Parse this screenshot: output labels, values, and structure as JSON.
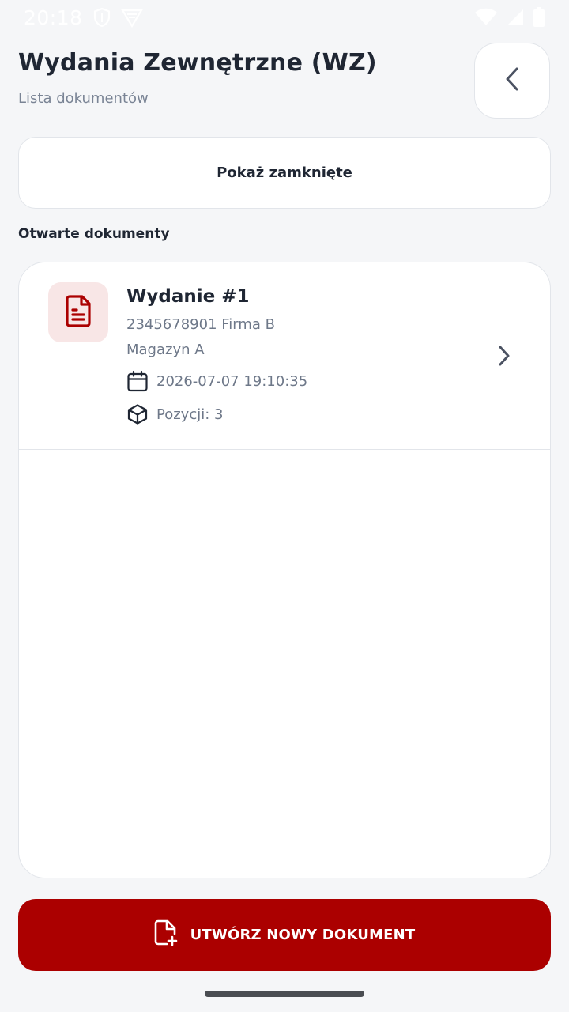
{
  "status_bar": {
    "time": "20:18",
    "icons": [
      "shield-icon",
      "app-logo-icon",
      "wifi-icon",
      "signal-icon",
      "battery-icon"
    ]
  },
  "header": {
    "title": "Wydania Zewnętrzne (WZ)",
    "subtitle": "Lista dokumentów",
    "back_icon": "chevron-left-icon"
  },
  "filter": {
    "show_closed_label": "Pokaż zamknięte"
  },
  "section": {
    "open_documents_title": "Otwarte dokumenty"
  },
  "documents": [
    {
      "title": "Wydanie #1",
      "contractor": "2345678901 Firma B",
      "warehouse": "Magazyn A",
      "date": "2026-07-07 19:10:35",
      "items": "Pozycji: 3",
      "icon": "document-icon"
    }
  ],
  "actions": {
    "create_label": "UTWÓRZ NOWY DOKUMENT",
    "create_icon": "file-plus-icon"
  },
  "colors": {
    "accent": "#ab0000",
    "icon_bg": "#f8e6e6",
    "background": "#f5f6f8",
    "text_primary": "#1f2633",
    "text_secondary": "#6e7889"
  }
}
